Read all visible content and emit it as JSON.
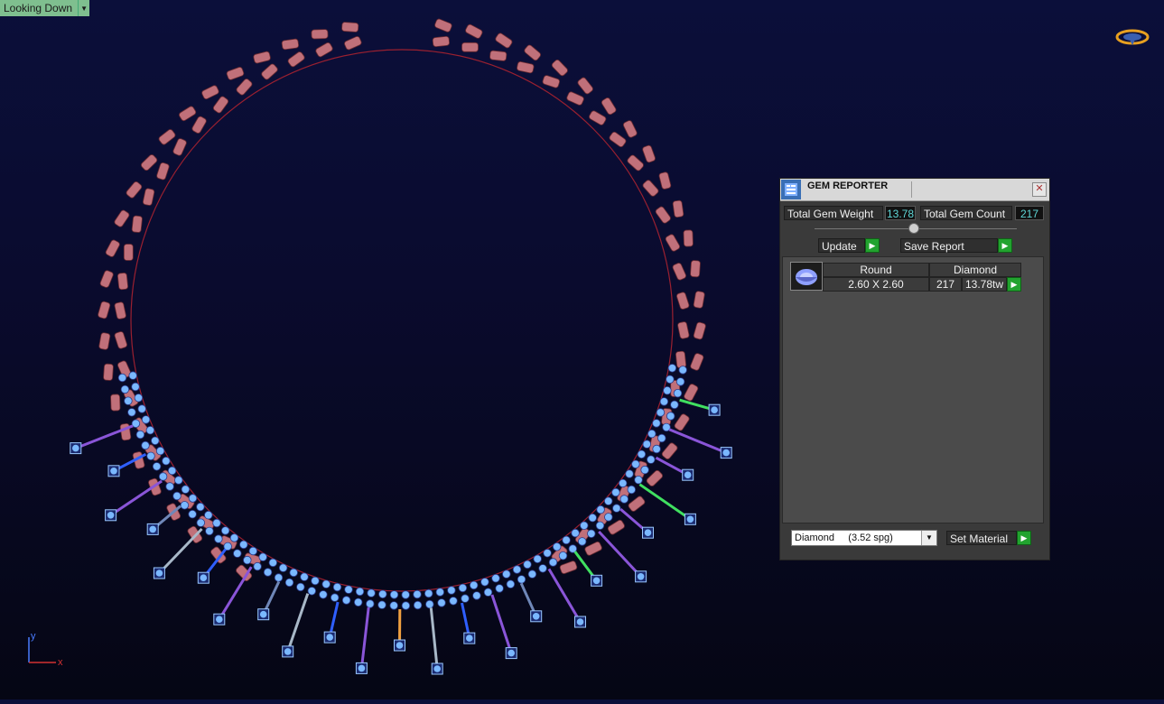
{
  "viewport": {
    "view_label": "Looking Down",
    "axis_y": "y",
    "axis_x": "x"
  },
  "gem_reporter": {
    "title": "GEM REPORTER",
    "close_glyph": "✕",
    "total_weight_label": "Total Gem Weight",
    "total_weight_value": "13.78",
    "total_count_label": "Total Gem Count",
    "total_count_value": "217",
    "update_label": "Update",
    "save_report_label": "Save Report",
    "table": {
      "headers": [
        "Round",
        "Diamond"
      ],
      "rows": [
        {
          "size": "2.60 X 2.60",
          "count": "217",
          "weight": "13.78tw"
        }
      ]
    },
    "material_select": "Diamond     (3.52 spg)",
    "set_material_label": "Set Material"
  },
  "colors": {
    "link_red": "#c0707a",
    "gem_blue": "#7ab8ff",
    "accent_green": "#22a32f",
    "value_cyan": "#5fd7d7",
    "highlight_orange": "#f0a040"
  }
}
